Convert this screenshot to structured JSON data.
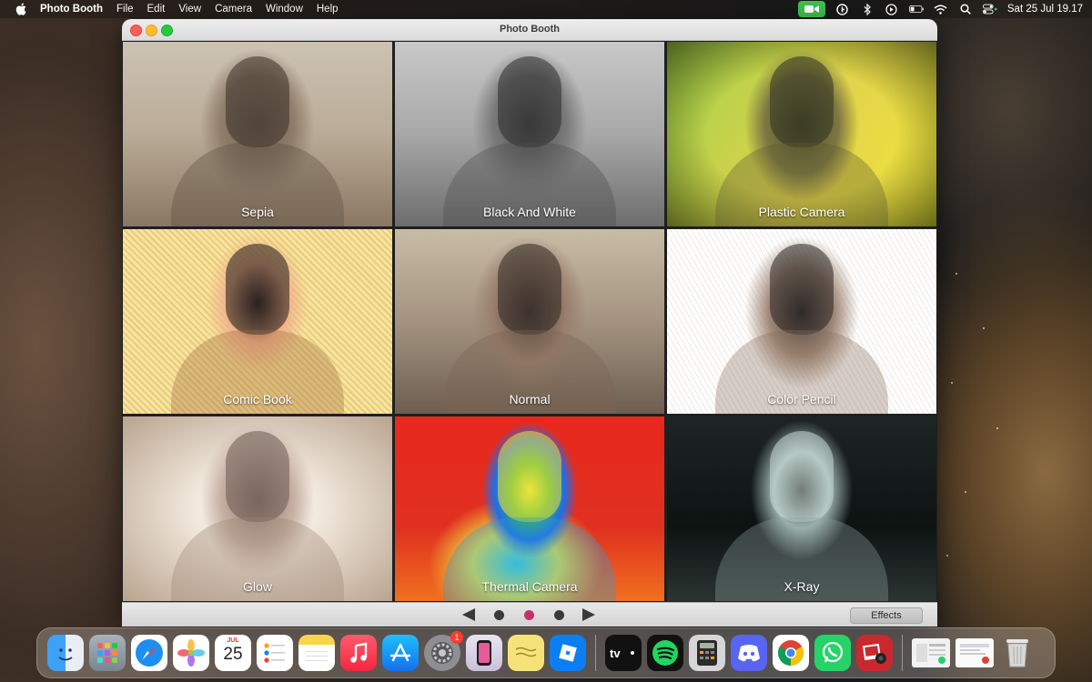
{
  "menubar": {
    "app_name": "Photo Booth",
    "items": [
      "File",
      "Edit",
      "View",
      "Camera",
      "Window",
      "Help"
    ],
    "clock": "Sat 25 Jul  19.17"
  },
  "window": {
    "title": "Photo Booth",
    "effects": [
      {
        "label": "Sepia"
      },
      {
        "label": "Black And White"
      },
      {
        "label": "Plastic Camera"
      },
      {
        "label": "Comic Book"
      },
      {
        "label": "Normal"
      },
      {
        "label": "Color Pencil"
      },
      {
        "label": "Glow"
      },
      {
        "label": "Thermal Camera"
      },
      {
        "label": "X-Ray"
      }
    ],
    "pager": {
      "pages": 3,
      "current": 2
    },
    "effects_button": "Effects"
  },
  "dock": {
    "calendar": {
      "month": "JUL",
      "day": "25"
    },
    "settings_badge": "1"
  },
  "colors": {
    "accent_dot": "#c8306c",
    "camera_indicator": "#3fc04f"
  }
}
